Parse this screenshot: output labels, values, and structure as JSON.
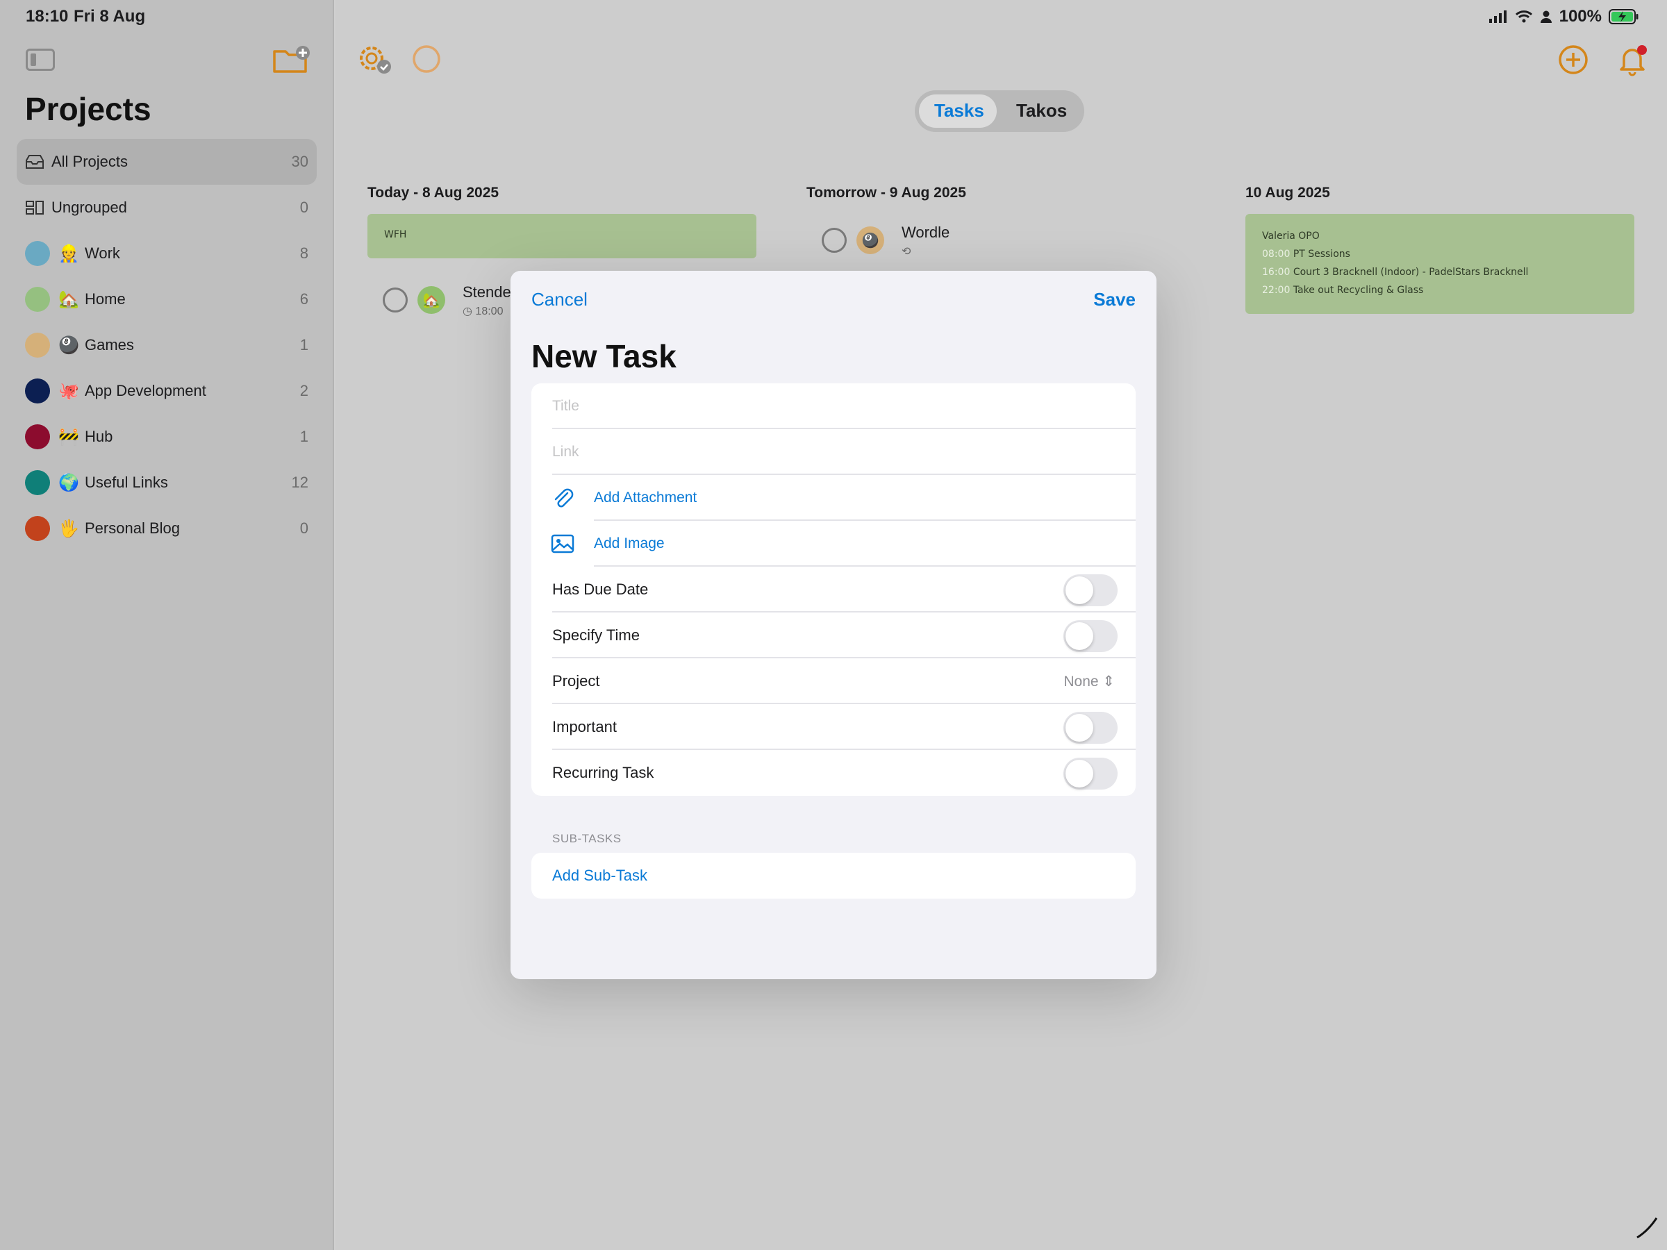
{
  "status": {
    "time": "18:10",
    "date": "Fri 8 Aug",
    "battery": "100%"
  },
  "sidebar": {
    "heading": "Projects",
    "items": [
      {
        "name": "All Projects",
        "count": "30",
        "icon": "tray-icon",
        "selected": true
      },
      {
        "name": "Ungrouped",
        "count": "0",
        "icon": "ungrouped-icon"
      },
      {
        "name": "Work",
        "count": "8",
        "emoji": "👷",
        "color": "#6aa9c2"
      },
      {
        "name": "Home",
        "count": "6",
        "emoji": "🏡",
        "color": "#95c080"
      },
      {
        "name": "Games",
        "count": "1",
        "emoji": "🎱",
        "color": "#d5b079"
      },
      {
        "name": "App Development",
        "count": "2",
        "emoji": "🐙",
        "color": "#0c1f52"
      },
      {
        "name": "Hub",
        "count": "1",
        "emoji": "🚧",
        "color": "#8c0c2e"
      },
      {
        "name": "Useful Links",
        "count": "12",
        "emoji": "🌍",
        "color": "#0f7f78"
      },
      {
        "name": "Personal Blog",
        "count": "0",
        "emoji": "🖐",
        "color": "#c2421c"
      }
    ]
  },
  "segment": {
    "tasks": "Tasks",
    "takos": "Takos",
    "selected": "Tasks"
  },
  "columns": [
    {
      "heading": "Today - 8 Aug 2025",
      "event_label": "WFH",
      "task_title": "Stende",
      "task_time": "18:00"
    },
    {
      "heading": "Tomorrow - 9 Aug 2025",
      "task_title": "Wordle"
    },
    {
      "heading": "10 Aug 2025",
      "event_title": "Valeria OPO",
      "events": [
        {
          "time": "08:00",
          "text": "PT Sessions"
        },
        {
          "time": "16:00",
          "text": "Court 3 Bracknell (Indoor) - PadelStars Bracknell"
        },
        {
          "time": "22:00",
          "text": "Take out Recycling & Glass"
        }
      ]
    }
  ],
  "modal": {
    "cancel": "Cancel",
    "save": "Save",
    "title": "New Task",
    "title_placeholder": "Title",
    "link_placeholder": "Link",
    "add_attachment": "Add Attachment",
    "add_image": "Add Image",
    "has_due_date": "Has Due Date",
    "specify_time": "Specify Time",
    "project": "Project",
    "project_value": "None",
    "important": "Important",
    "recurring": "Recurring Task",
    "subtasks_caption": "SUB-TASKS",
    "add_subtask": "Add Sub-Task",
    "toggles": {
      "has_due_date": false,
      "specify_time": false,
      "important": false,
      "recurring": false
    }
  },
  "colors": {
    "accent_blue": "#0a7ad6",
    "accent_orange": "#d4861a",
    "event_green": "#a7c091"
  }
}
